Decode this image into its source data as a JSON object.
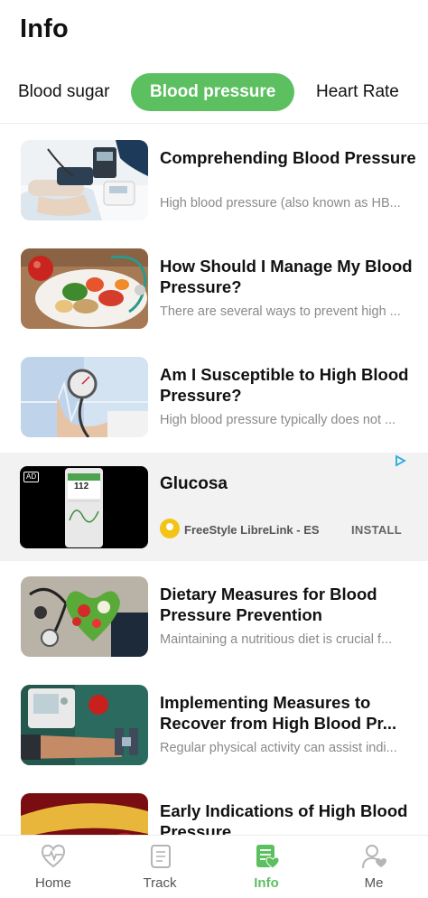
{
  "header": {
    "title": "Info"
  },
  "tabs": [
    {
      "label": "Blood sugar"
    },
    {
      "label": "Blood pressure",
      "active": true
    },
    {
      "label": "Heart Rate"
    }
  ],
  "articles": [
    {
      "title": "Comprehending Blood Pressure",
      "desc": "High blood pressure (also known as HB..."
    },
    {
      "title": "How Should I Manage My Blood Pressure?",
      "desc": "There are several ways to prevent high ..."
    },
    {
      "title": "Am I Susceptible to High Blood Pressure?",
      "desc": "High blood pressure typically does not ..."
    },
    {
      "title": "Dietary Measures for Blood Pressure Prevention",
      "desc": "Maintaining a nutritious diet is crucial f..."
    },
    {
      "title": "Implementing Measures to Recover from High Blood Pr...",
      "desc": "Regular physical activity can assist indi..."
    },
    {
      "title": "Early Indications of High Blood Pressure",
      "desc": ""
    }
  ],
  "ad": {
    "badge": "AD",
    "title": "Glucosa",
    "brand": "FreeStyle LibreLink - ES",
    "cta": "INSTALL",
    "screen_value": "112"
  },
  "nav": [
    {
      "label": "Home",
      "icon": "heart-pulse-icon"
    },
    {
      "label": "Track",
      "icon": "scroll-icon"
    },
    {
      "label": "Info",
      "icon": "info-document-icon",
      "active": true
    },
    {
      "label": "Me",
      "icon": "person-heart-icon"
    }
  ],
  "colors": {
    "accent": "#5cbf60",
    "text": "#111111",
    "muted": "#8a8a8a",
    "ad_bg": "#f2f2f2"
  }
}
